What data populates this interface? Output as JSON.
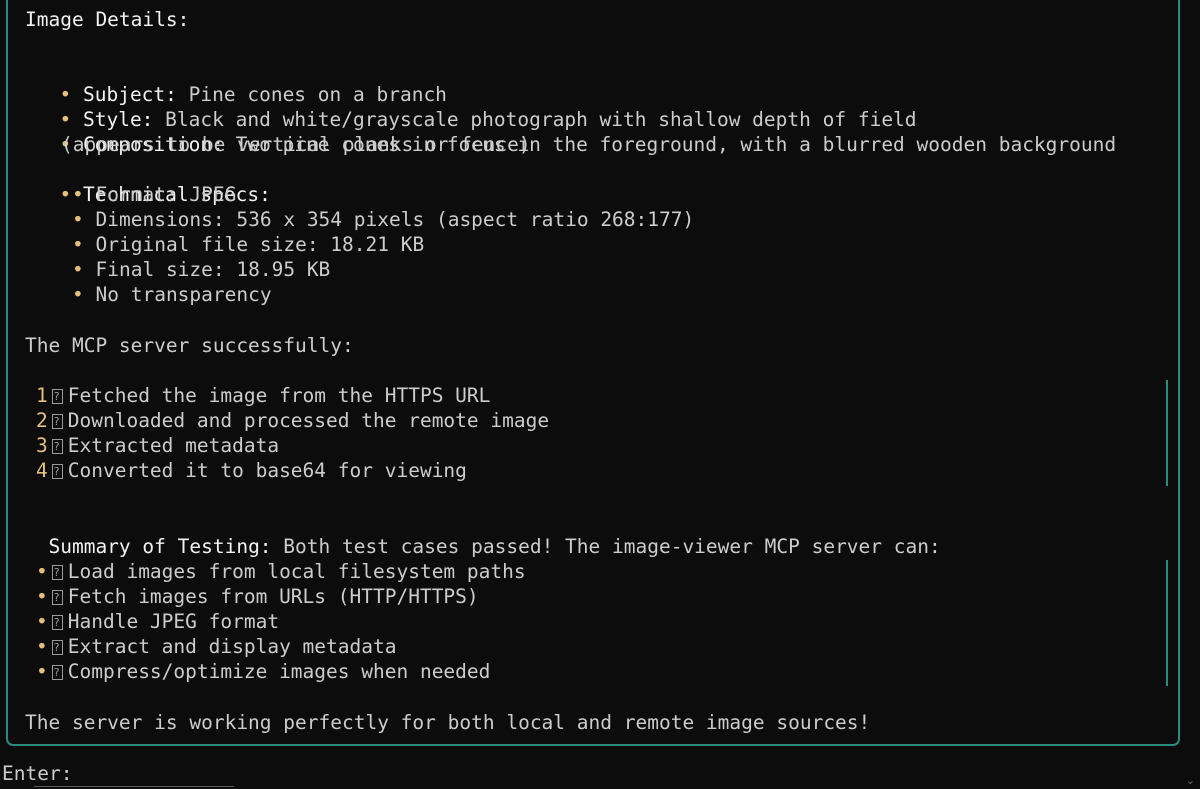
{
  "image_details": {
    "heading": "Image Details:",
    "subject": {
      "label": "Subject:",
      "value": " Pine cones on a branch"
    },
    "style": {
      "label": "Style:",
      "value": " Black and white/grayscale photograph with shallow depth of field"
    },
    "composition": {
      "label": "Composition:",
      "value": " Two pine cones in focus in the foreground, with a blurred wooden background",
      "cont": "(appears to be vertical planks or fence)"
    },
    "technical": {
      "label": "Technical specs:",
      "items": [
        "Format: JPEG",
        "Dimensions: 536 x 354 pixels (aspect ratio 268:177)",
        "Original file size: 18.21 KB",
        "Final size: 18.95 KB",
        "No transparency"
      ]
    }
  },
  "mcp": {
    "intro": "The MCP server successfully:",
    "steps": [
      {
        "num": "1",
        "text": "Fetched the image from the HTTPS URL"
      },
      {
        "num": "2",
        "text": "Downloaded and processed the remote image"
      },
      {
        "num": "3",
        "text": "Extracted metadata"
      },
      {
        "num": "4",
        "text": "Converted it to base64 for viewing"
      }
    ]
  },
  "summary": {
    "label": "Summary of Testing:",
    "value": " Both test cases passed! The image-viewer MCP server can:",
    "items": [
      "Load images from local filesystem paths",
      "Fetch images from URLs (HTTP/HTTPS)",
      "Handle JPEG format",
      "Extract and display metadata",
      "Compress/optimize images when needed"
    ],
    "conclusion": "The server is working perfectly for both local and remote image sources!"
  },
  "prompt": {
    "label": "Enter:"
  },
  "colors": {
    "border": "#2a8c7c",
    "bullet": "#e5c07b",
    "background": "#0c0c0c"
  }
}
